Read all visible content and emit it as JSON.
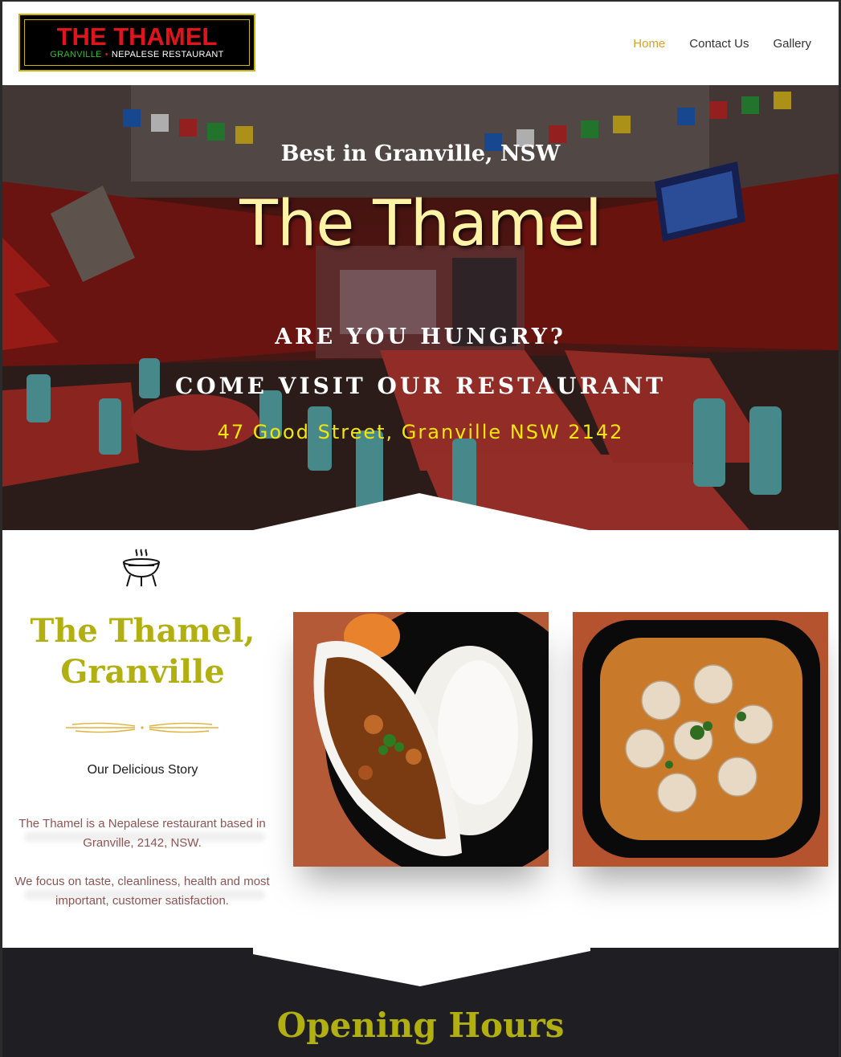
{
  "brand": {
    "logo_title": "THE THAMEL",
    "logo_sub_green": "GRANVILLE",
    "logo_sub_white": "NEPALESE RESTAURANT"
  },
  "nav": {
    "items": [
      {
        "label": "Home",
        "active": true
      },
      {
        "label": "Contact Us",
        "active": false
      },
      {
        "label": "Gallery",
        "active": false
      }
    ]
  },
  "hero": {
    "kicker": "Best in Granville, NSW",
    "title": "The Thamel",
    "line1": "ARE YOU HUNGRY?",
    "line2": "COME VISIT OUR RESTAURANT",
    "address": "47 Good Street, Granville NSW 2142"
  },
  "story": {
    "icon": "grill-icon",
    "title_line1": "The Thamel,",
    "title_line2": "Granville",
    "subtitle": "Our Delicious Story",
    "paragraph1": "The Thamel is a Nepalese restaurant based in Granville, 2142, NSW.",
    "paragraph2": "We focus on taste, cleanliness, health and most important, customer satisfaction."
  },
  "hours": {
    "title": "Opening Hours"
  },
  "colors": {
    "accent_olive": "#b2b011",
    "nav_active": "#d9a31d",
    "address_yellow": "#f2e60a",
    "logo_red": "#e2141b",
    "dark_bg": "#1f1e23"
  }
}
